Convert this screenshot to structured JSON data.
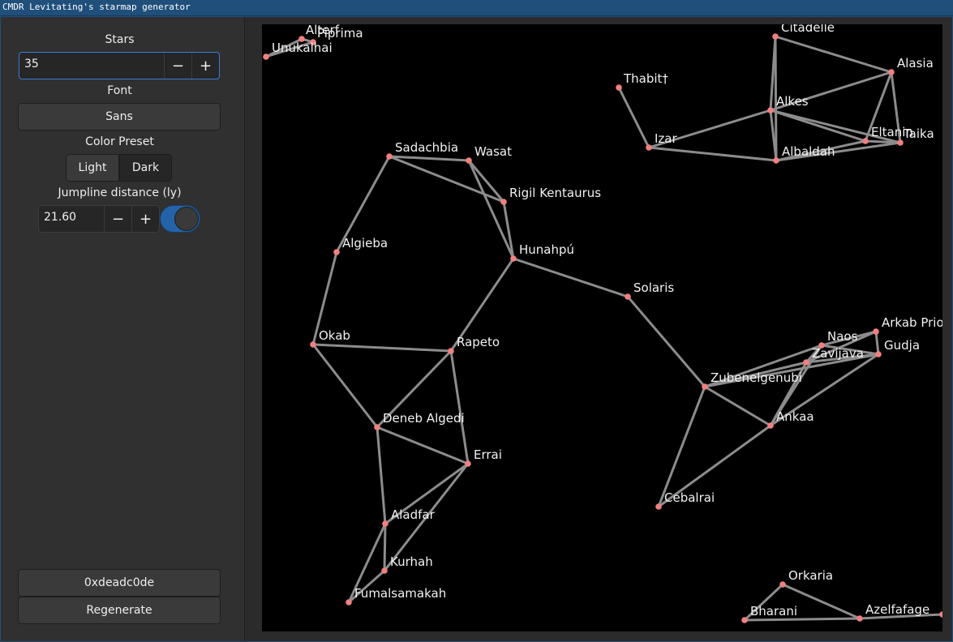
{
  "window": {
    "title": "CMDR Levitating's starmap generator"
  },
  "sidebar": {
    "stars_label": "Stars",
    "stars_value": "35",
    "font_label": "Font",
    "font_value": "Sans",
    "color_preset_label": "Color Preset",
    "preset_light": "Light",
    "preset_dark": "Dark",
    "jumpline_label": "Jumpline distance (ly)",
    "jumpline_value": "21.60",
    "jumpline_enabled": true,
    "minus_glyph": "−",
    "plus_glyph": "+",
    "seed_value": "0xdeadc0de",
    "regenerate_label": "Regenerate"
  },
  "map": {
    "stars": [
      {
        "name": "Alterf"
      },
      {
        "name": "Piprima"
      },
      {
        "name": "Unukalhai"
      },
      {
        "name": "Citadelle"
      },
      {
        "name": "Alasia"
      },
      {
        "name": "Thabit†"
      },
      {
        "name": "Alkes"
      },
      {
        "name": "Izar"
      },
      {
        "name": "Eltanin"
      },
      {
        "name": "Taika"
      },
      {
        "name": "Albaldah"
      },
      {
        "name": "Sadachbia"
      },
      {
        "name": "Wasat"
      },
      {
        "name": "Rigil Kentaurus"
      },
      {
        "name": "Algieba"
      },
      {
        "name": "Hunahpú"
      },
      {
        "name": "Solaris"
      },
      {
        "name": "Okab"
      },
      {
        "name": "Rapeto"
      },
      {
        "name": "Arkab Prior"
      },
      {
        "name": "Naos"
      },
      {
        "name": "Gudja"
      },
      {
        "name": "Zavijava"
      },
      {
        "name": "Zubenelgenubi"
      },
      {
        "name": "Ankaa"
      },
      {
        "name": "Deneb Algedi"
      },
      {
        "name": "Errai"
      },
      {
        "name": "Cebalrai"
      },
      {
        "name": "Aladfar"
      },
      {
        "name": "Kurhah"
      },
      {
        "name": "Fumalsamakah"
      },
      {
        "name": "Orkaria"
      },
      {
        "name": "Bharani"
      },
      {
        "name": "Azelfafage"
      },
      {
        "name": ""
      }
    ],
    "jumplines": [
      [
        "Unukalhai",
        "Alterf"
      ],
      [
        "Alterf",
        "Piprima"
      ],
      [
        "Unukalhai",
        "Piprima"
      ],
      [
        "Citadelle",
        "Alasia"
      ],
      [
        "Citadelle",
        "Alkes"
      ],
      [
        "Citadelle",
        "Albaldah"
      ],
      [
        "Alasia",
        "Alkes"
      ],
      [
        "Alasia",
        "Eltanin"
      ],
      [
        "Alasia",
        "Taika"
      ],
      [
        "Thabit†",
        "Izar"
      ],
      [
        "Izar",
        "Alkes"
      ],
      [
        "Izar",
        "Albaldah"
      ],
      [
        "Alkes",
        "Albaldah"
      ],
      [
        "Alkes",
        "Eltanin"
      ],
      [
        "Alkes",
        "Taika"
      ],
      [
        "Eltanin",
        "Taika"
      ],
      [
        "Albaldah",
        "Eltanin"
      ],
      [
        "Albaldah",
        "Taika"
      ],
      [
        "Sadachbia",
        "Wasat"
      ],
      [
        "Sadachbia",
        "Rigil Kentaurus"
      ],
      [
        "Sadachbia",
        "Algieba"
      ],
      [
        "Wasat",
        "Rigil Kentaurus"
      ],
      [
        "Wasat",
        "Hunahpú"
      ],
      [
        "Rigil Kentaurus",
        "Hunahpú"
      ],
      [
        "Hunahpú",
        "Solaris"
      ],
      [
        "Hunahpú",
        "Rapeto"
      ],
      [
        "Algieba",
        "Okab"
      ],
      [
        "Okab",
        "Rapeto"
      ],
      [
        "Okab",
        "Deneb Algedi"
      ],
      [
        "Rapeto",
        "Deneb Algedi"
      ],
      [
        "Rapeto",
        "Errai"
      ],
      [
        "Deneb Algedi",
        "Errai"
      ],
      [
        "Deneb Algedi",
        "Aladfar"
      ],
      [
        "Errai",
        "Aladfar"
      ],
      [
        "Errai",
        "Kurhah"
      ],
      [
        "Aladfar",
        "Kurhah"
      ],
      [
        "Aladfar",
        "Fumalsamakah"
      ],
      [
        "Kurhah",
        "Fumalsamakah"
      ],
      [
        "Solaris",
        "Zubenelgenubi"
      ],
      [
        "Zubenelgenubi",
        "Cebalrai"
      ],
      [
        "Zubenelgenubi",
        "Ankaa"
      ],
      [
        "Zubenelgenubi",
        "Naos"
      ],
      [
        "Zubenelgenubi",
        "Zavijava"
      ],
      [
        "Zubenelgenubi",
        "Gudja"
      ],
      [
        "Cebalrai",
        "Ankaa"
      ],
      [
        "Ankaa",
        "Zavijava"
      ],
      [
        "Ankaa",
        "Naos"
      ],
      [
        "Ankaa",
        "Gudja"
      ],
      [
        "Naos",
        "Zavijava"
      ],
      [
        "Naos",
        "Gudja"
      ],
      [
        "Naos",
        "Arkab Prior"
      ],
      [
        "Zavijava",
        "Gudja"
      ],
      [
        "Zavijava",
        "Arkab Prior"
      ],
      [
        "Arkab Prior",
        "Gudja"
      ],
      [
        "Orkaria",
        "Bharani"
      ],
      [
        "Orkaria",
        "Azelfafage"
      ],
      [
        "Bharani",
        "Azelfafage"
      ],
      [
        "Azelfafage",
        ""
      ]
    ],
    "colors": {
      "background": "#000000",
      "star": "#f08080",
      "jumpline": "#8c8c8c",
      "label": "#f2f2f2"
    }
  }
}
